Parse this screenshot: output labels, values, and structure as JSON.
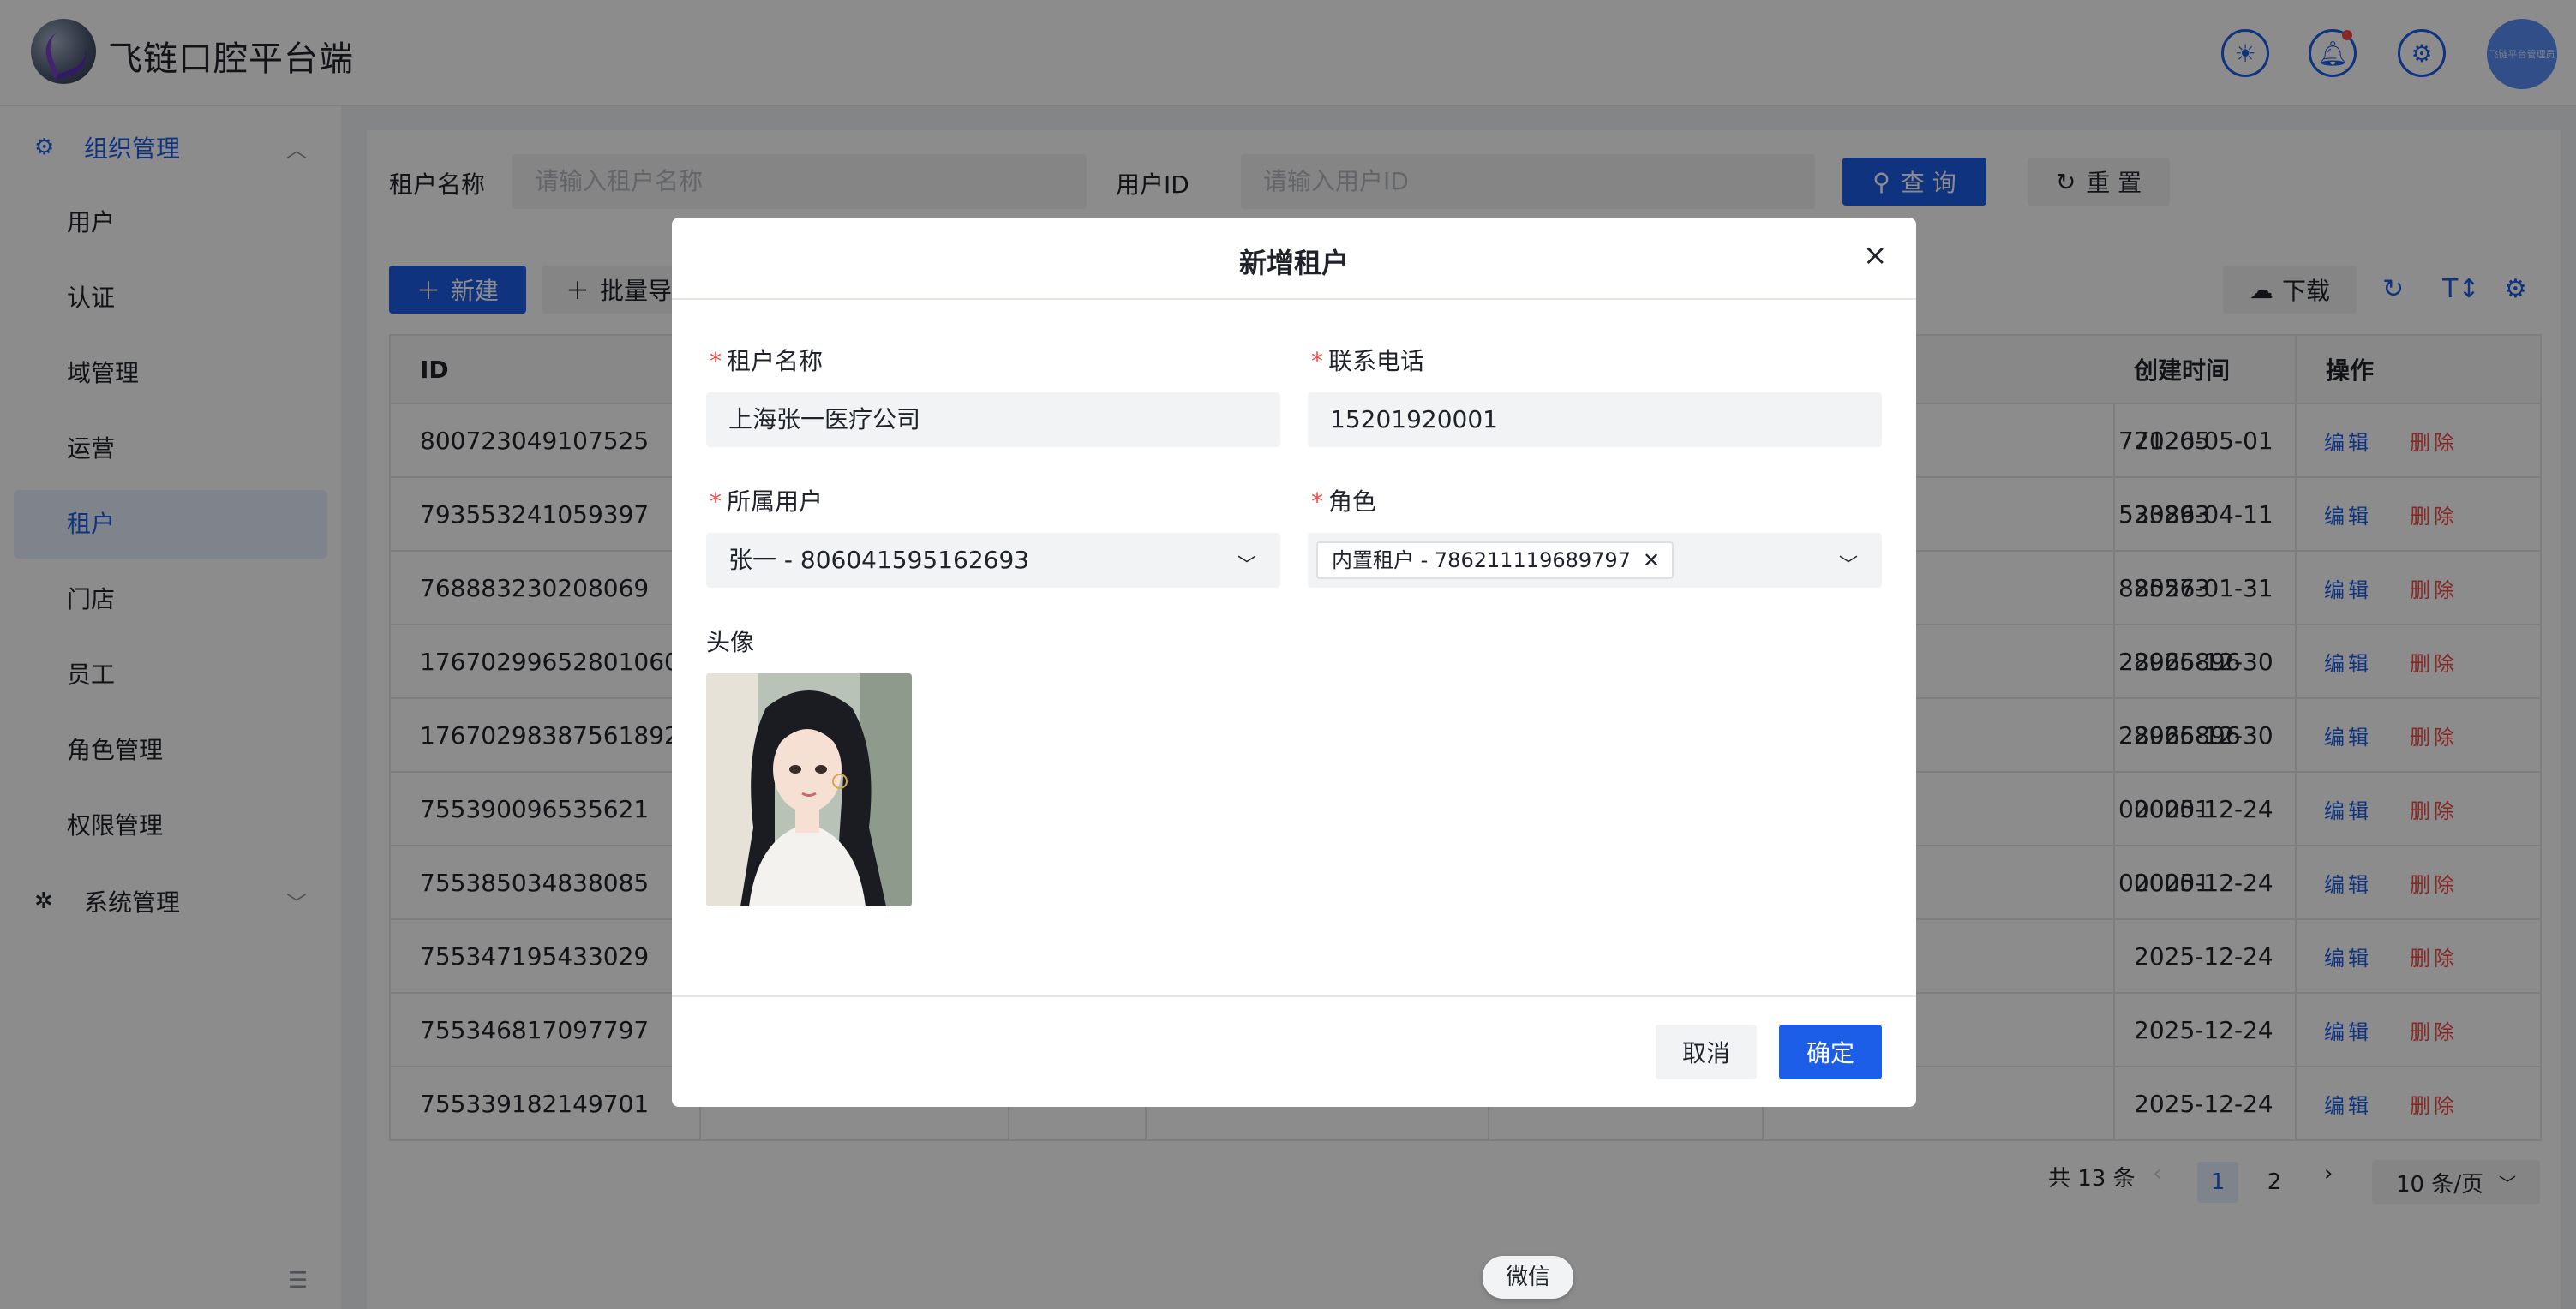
{
  "app": {
    "title": "飞链口腔平台端",
    "avatar_text": "飞链平台管理员"
  },
  "sidebar": {
    "group1": {
      "label": "组织管理"
    },
    "items": [
      {
        "label": "用户"
      },
      {
        "label": "认证"
      },
      {
        "label": "域管理"
      },
      {
        "label": "运营"
      },
      {
        "label": "租户"
      },
      {
        "label": "门店"
      },
      {
        "label": "员工"
      },
      {
        "label": "角色管理"
      },
      {
        "label": "权限管理"
      }
    ],
    "group2": {
      "label": "系统管理"
    }
  },
  "search": {
    "tenant_label": "租户名称",
    "tenant_placeholder": "请输入租户名称",
    "user_label": "用户ID",
    "user_placeholder": "请输入用户ID",
    "query": "查 询",
    "reset": "重 置"
  },
  "toolbar": {
    "new": "新建",
    "batch": "批量导",
    "download": "下载"
  },
  "table": {
    "headers": {
      "id": "ID",
      "created": "创建时间",
      "ops": "操作"
    },
    "rows": [
      {
        "id": "800723049107525",
        "phone": "771205",
        "created": "2026-05-01"
      },
      {
        "id": "793553241059397",
        "phone": "533893",
        "created": "2026-04-11"
      },
      {
        "id": "768883230208069",
        "phone": "885573",
        "created": "2026-01-31"
      },
      {
        "id": "17670299652801060",
        "phone": "28966896",
        "created": "2025-12-30"
      },
      {
        "id": "17670298387561892",
        "phone": "28966896",
        "created": "2025-12-30"
      },
      {
        "id": "755390096535621",
        "phone": "000001",
        "created": "2025-12-24"
      },
      {
        "id": "755385034838085",
        "phone": "000001",
        "created": "2025-12-24"
      },
      {
        "id": "755347195433029",
        "phone": "",
        "created": "2025-12-24"
      },
      {
        "id": "755346817097797",
        "phone": "",
        "created": "2025-12-24"
      },
      {
        "id": "755339182149701",
        "phone": "",
        "created": "2025-12-24"
      }
    ],
    "edit": "编辑",
    "delete": "删除"
  },
  "pagination": {
    "total": "共 13 条",
    "page1": "1",
    "page2": "2",
    "page_size": "10 条/页"
  },
  "modal": {
    "title": "新增租户",
    "tenant_name_label": "租户名称",
    "tenant_name_value": "上海张一医疗公司",
    "phone_label": "联系电话",
    "phone_value": "15201920001",
    "owner_label": "所属用户",
    "owner_value": "张一 - 806041595162693",
    "role_label": "角色",
    "role_tag": "内置租户 - 786211119689797",
    "avatar_label": "头像",
    "cancel": "取消",
    "confirm": "确定"
  },
  "tooltip": "微信",
  "colors": {
    "primary": "#1c5ee8",
    "danger": "#f54a45",
    "mask": "rgba(0,0,0,0.45)"
  }
}
